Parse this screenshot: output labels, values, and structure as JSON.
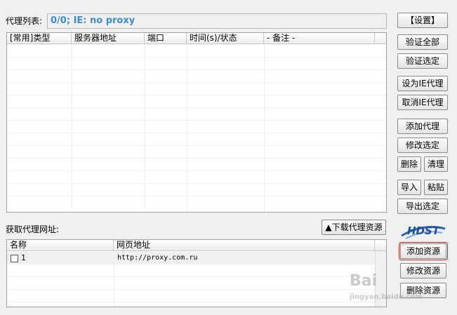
{
  "proxy_section": {
    "label": "代理列表:",
    "status": "0/0;   IE: no proxy",
    "columns": [
      "[常用]类型",
      "服务器地址",
      "端口",
      "时间(s)/状态",
      "- 备注 -"
    ]
  },
  "fetch_section": {
    "label": "获取代理网址:",
    "download_button": "▲下载代理资源",
    "columns": [
      "名称",
      "网页地址"
    ],
    "rows": [
      {
        "name": "1",
        "url": "http://proxy.com.ru",
        "checked": false
      }
    ]
  },
  "buttons": {
    "settings": "【设置】",
    "verify_all": "验证全部",
    "verify_selected": "验证选定",
    "set_ie_proxy": "设为IE代理",
    "cancel_ie_proxy": "取消IE代理",
    "add_proxy": "添加代理",
    "edit_selected": "修改选定",
    "delete": "删除",
    "clear": "清理",
    "import": "导入",
    "paste": "粘贴",
    "export_selected": "导出选定",
    "add_resource": "添加资源",
    "edit_resource": "修改资源",
    "delete_resource": "删除资源"
  },
  "logo": {
    "text": "HDST"
  },
  "watermark": {
    "text": "Bai",
    "sub": "jingyan.baidu.com"
  }
}
